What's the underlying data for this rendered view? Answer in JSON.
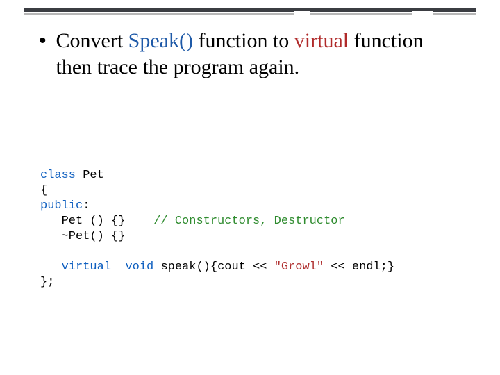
{
  "bullet": {
    "pre": "Convert ",
    "fn": "Speak()",
    "mid1": " function to ",
    "kw": "virtual",
    "rest": " function then trace the program again."
  },
  "code": {
    "l1_kw": "class",
    "l1_rest": " Pet",
    "l2": "{",
    "l3_kw": "public",
    "l3_rest": ":",
    "l4_indent": "   Pet () {}    ",
    "l4_cmt": "// Constructors, Destructor",
    "l5": "   ~Pet() {}",
    "blank": "",
    "l6_indent": "   ",
    "l6_virtual": "virtual",
    "l6_gap": "  ",
    "l6_void": "void",
    "l6_mid": " speak(){cout << ",
    "l6_str": "\"Growl\"",
    "l6_tail": " << endl;}",
    "l7": "};"
  }
}
